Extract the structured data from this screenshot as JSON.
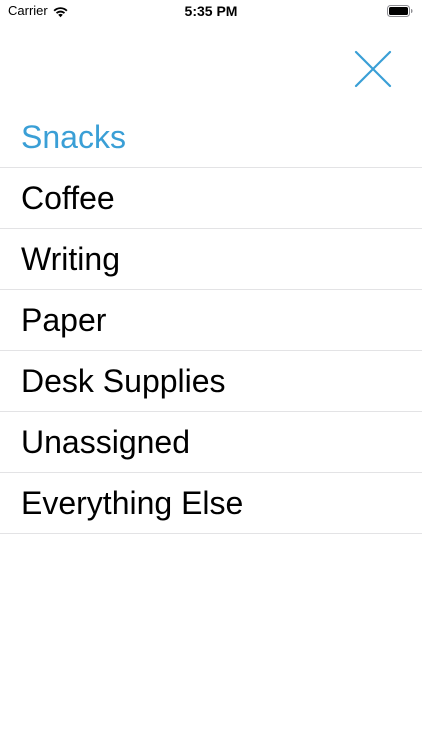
{
  "status_bar": {
    "carrier": "Carrier",
    "time": "5:35 PM",
    "icons": [
      "wifi-icon",
      "battery-icon"
    ]
  },
  "close_button": {
    "icon": "close-icon",
    "color": "#3a9fd6"
  },
  "categories": {
    "selected_color": "#3a9fd6",
    "selected_index": 0,
    "items": [
      {
        "label": "Snacks"
      },
      {
        "label": "Coffee"
      },
      {
        "label": "Writing"
      },
      {
        "label": "Paper"
      },
      {
        "label": "Desk Supplies"
      },
      {
        "label": "Unassigned"
      },
      {
        "label": "Everything Else"
      }
    ]
  }
}
